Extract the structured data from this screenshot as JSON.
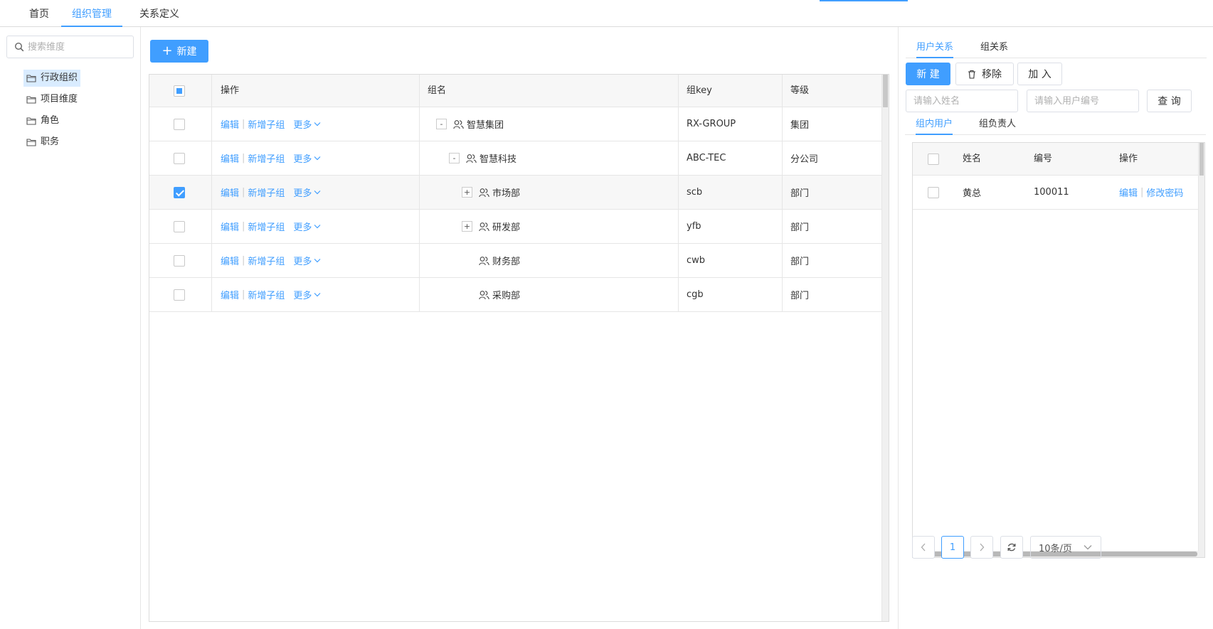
{
  "top_tabs": [
    {
      "label": "首页"
    },
    {
      "label": "组织管理",
      "active": true
    },
    {
      "label": "关系定义"
    }
  ],
  "sidebar": {
    "search_placeholder": "搜索维度",
    "items": [
      {
        "label": "行政组织",
        "active": true
      },
      {
        "label": "项目维度"
      },
      {
        "label": "角色"
      },
      {
        "label": "职务"
      }
    ]
  },
  "toolbar": {
    "new_label": "新建"
  },
  "org_table": {
    "columns": {
      "actions": "操作",
      "name": "组名",
      "key": "组key",
      "level": "等级"
    },
    "action_labels": {
      "edit": "编辑",
      "add_child": "新增子组",
      "more": "更多"
    },
    "rows": [
      {
        "toggle": "-",
        "name": "智慧集团",
        "key": "RX-GROUP",
        "level": "集团",
        "checked": false
      },
      {
        "toggle": "-",
        "name": "智慧科技",
        "key": "ABC-TEC",
        "level": "分公司",
        "checked": false
      },
      {
        "toggle": "+",
        "name": "市场部",
        "key": "scb",
        "level": "部门",
        "checked": true
      },
      {
        "toggle": "+",
        "name": "研发部",
        "key": "yfb",
        "level": "部门",
        "checked": false
      },
      {
        "toggle": "",
        "name": "财务部",
        "key": "cwb",
        "level": "部门",
        "checked": false
      },
      {
        "toggle": "",
        "name": "采购部",
        "key": "cgb",
        "level": "部门",
        "checked": false
      }
    ]
  },
  "right_panel": {
    "tabs": [
      {
        "label": "用户关系",
        "active": true
      },
      {
        "label": "组关系"
      }
    ],
    "buttons": {
      "new": "新 建",
      "remove": "移除",
      "join": "加 入",
      "query": "查 询"
    },
    "inputs": {
      "name_placeholder": "请输入姓名",
      "code_placeholder": "请输入用户编号"
    },
    "sub_tabs": [
      {
        "label": "组内用户",
        "active": true
      },
      {
        "label": "组负责人"
      }
    ],
    "user_table": {
      "columns": {
        "name": "姓名",
        "code": "编号",
        "actions": "操作"
      },
      "rows": [
        {
          "name": "黄总",
          "code": "100011",
          "edit": "编辑",
          "change_password": "修改密码"
        }
      ]
    },
    "pagination": {
      "current_page": "1",
      "page_size": "10条/页"
    }
  },
  "colors": {
    "accent": "#409eff",
    "border": "#dcdcdc",
    "header_bg": "#f7f7f7"
  }
}
